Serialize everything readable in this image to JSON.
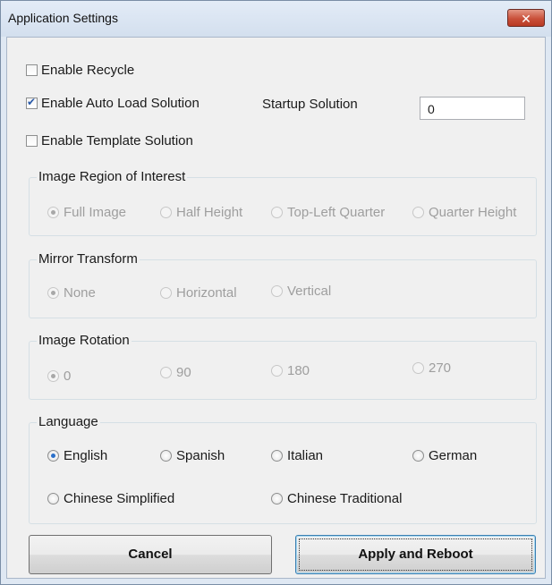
{
  "window": {
    "title": "Application Settings",
    "close_glyph": "✕"
  },
  "options": {
    "enable_recycle": {
      "label": "Enable Recycle",
      "checked": false
    },
    "enable_auto_load": {
      "label": "Enable Auto Load Solution",
      "checked": true
    },
    "startup_solution": {
      "label": "Startup Solution",
      "value": "0"
    },
    "enable_template": {
      "label": "Enable Template Solution",
      "checked": false
    }
  },
  "roi": {
    "title": "Image Region of Interest",
    "enabled": false,
    "options": [
      "Full Image",
      "Half Height",
      "Top-Left Quarter",
      "Quarter Height"
    ],
    "selected": "Full Image"
  },
  "mirror": {
    "title": "Mirror Transform",
    "enabled": false,
    "options": [
      "None",
      "Horizontal",
      "Vertical"
    ],
    "selected": "None"
  },
  "rotation": {
    "title": "Image Rotation",
    "enabled": false,
    "options": [
      "0",
      "90",
      "180",
      "270"
    ],
    "selected": "0"
  },
  "language": {
    "title": "Language",
    "enabled": true,
    "options": [
      "English",
      "Spanish",
      "Italian",
      "German",
      "Chinese Simplified",
      "Chinese Traditional"
    ],
    "selected": "English"
  },
  "buttons": {
    "cancel": "Cancel",
    "apply": "Apply and Reboot"
  }
}
